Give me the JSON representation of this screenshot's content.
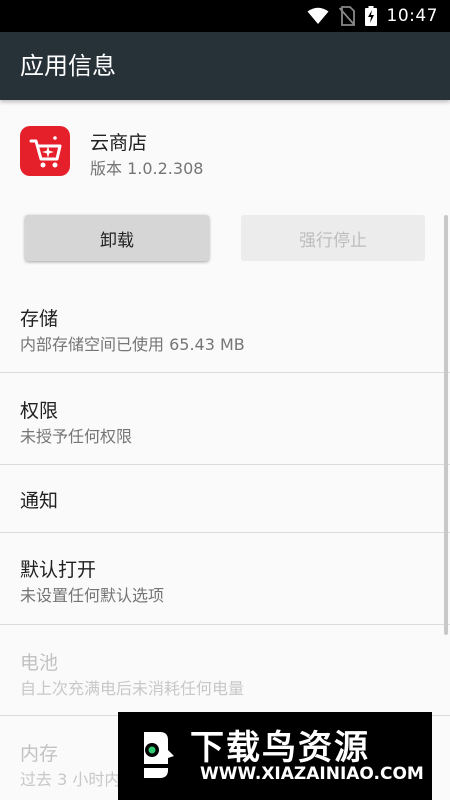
{
  "status_bar": {
    "time": "10:47",
    "icons": [
      "wifi-icon",
      "no-sim-icon",
      "battery-charging-icon"
    ]
  },
  "app_bar": {
    "title": "应用信息"
  },
  "app": {
    "name": "云商店",
    "version": "版本 1.0.2.308",
    "icon": "shopping-cart-icon",
    "icon_color": "#e6202b"
  },
  "buttons": {
    "uninstall": "卸载",
    "force_stop": "强行停止"
  },
  "rows": [
    {
      "title": "存储",
      "subtitle": "内部存储空间已使用 65.43 MB"
    },
    {
      "title": "权限",
      "subtitle": "未授予任何权限"
    },
    {
      "title": "通知"
    },
    {
      "title": "默认打开",
      "subtitle": "未设置任何默认选项"
    },
    {
      "title": "电池",
      "subtitle": "自上次充满电后未消耗任何电量"
    },
    {
      "title": "内存",
      "subtitle": "过去 3 小时内"
    }
  ],
  "watermark": {
    "title": "下载鸟资源",
    "url": "WWW.XIAZAINIAO.COM"
  },
  "colors": {
    "app_bar": "#263238",
    "background": "#fafafa"
  }
}
